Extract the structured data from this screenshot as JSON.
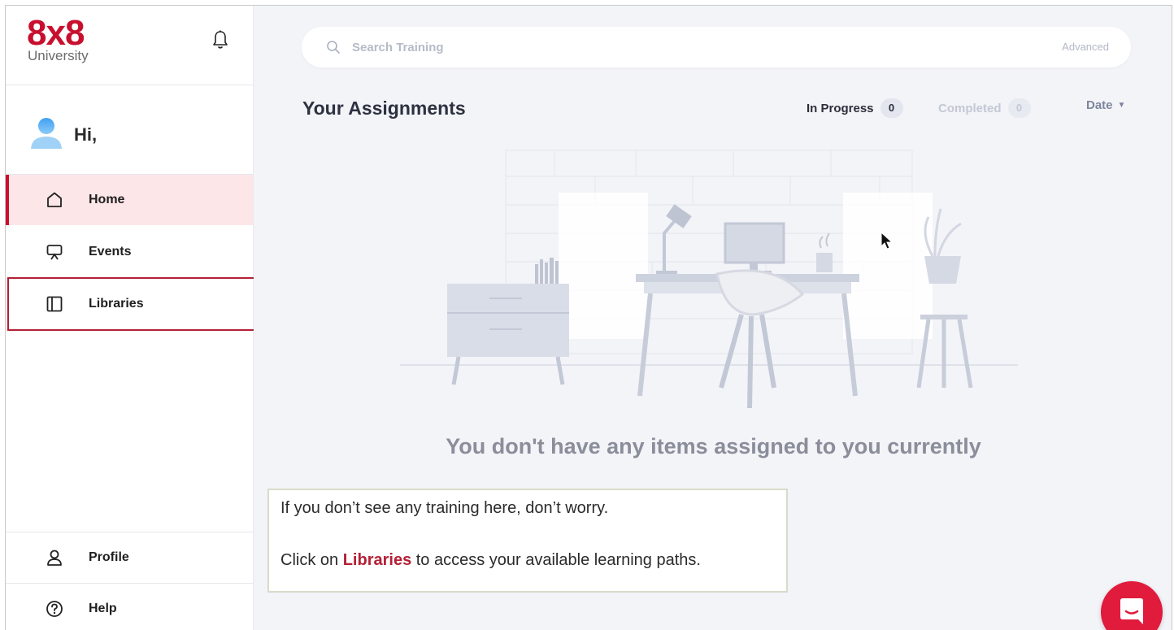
{
  "logo": {
    "mark": "8x8",
    "subtitle": "University"
  },
  "user": {
    "greeting": "Hi,"
  },
  "nav": {
    "items": [
      {
        "label": "Home",
        "icon": "home-icon",
        "active": true
      },
      {
        "label": "Events",
        "icon": "presentation-icon",
        "active": false
      },
      {
        "label": "Libraries",
        "icon": "book-icon",
        "active": false
      }
    ],
    "bottom": [
      {
        "label": "Profile",
        "icon": "user-icon"
      },
      {
        "label": "Help",
        "icon": "help-icon"
      }
    ]
  },
  "search": {
    "placeholder": "Search Training",
    "advanced_label": "Advanced"
  },
  "assignments": {
    "title": "Your Assignments",
    "tabs": [
      {
        "label": "In Progress",
        "count": "0",
        "active": true
      },
      {
        "label": "Completed",
        "count": "0",
        "active": false
      }
    ],
    "sort_label": "Date",
    "empty_message": "You don't have any items assigned to you currently"
  },
  "callout": {
    "line1": "If you don’t see any training here, don’t worry.",
    "line2_prefix": "Click on ",
    "line2_highlight": "Libraries",
    "line2_suffix": " to access your available learning paths."
  },
  "colors": {
    "brand": "#c8102e",
    "active_nav_bg": "#fde6e8",
    "main_bg": "#f3f4f8",
    "callout_highlight": "#b32036"
  }
}
